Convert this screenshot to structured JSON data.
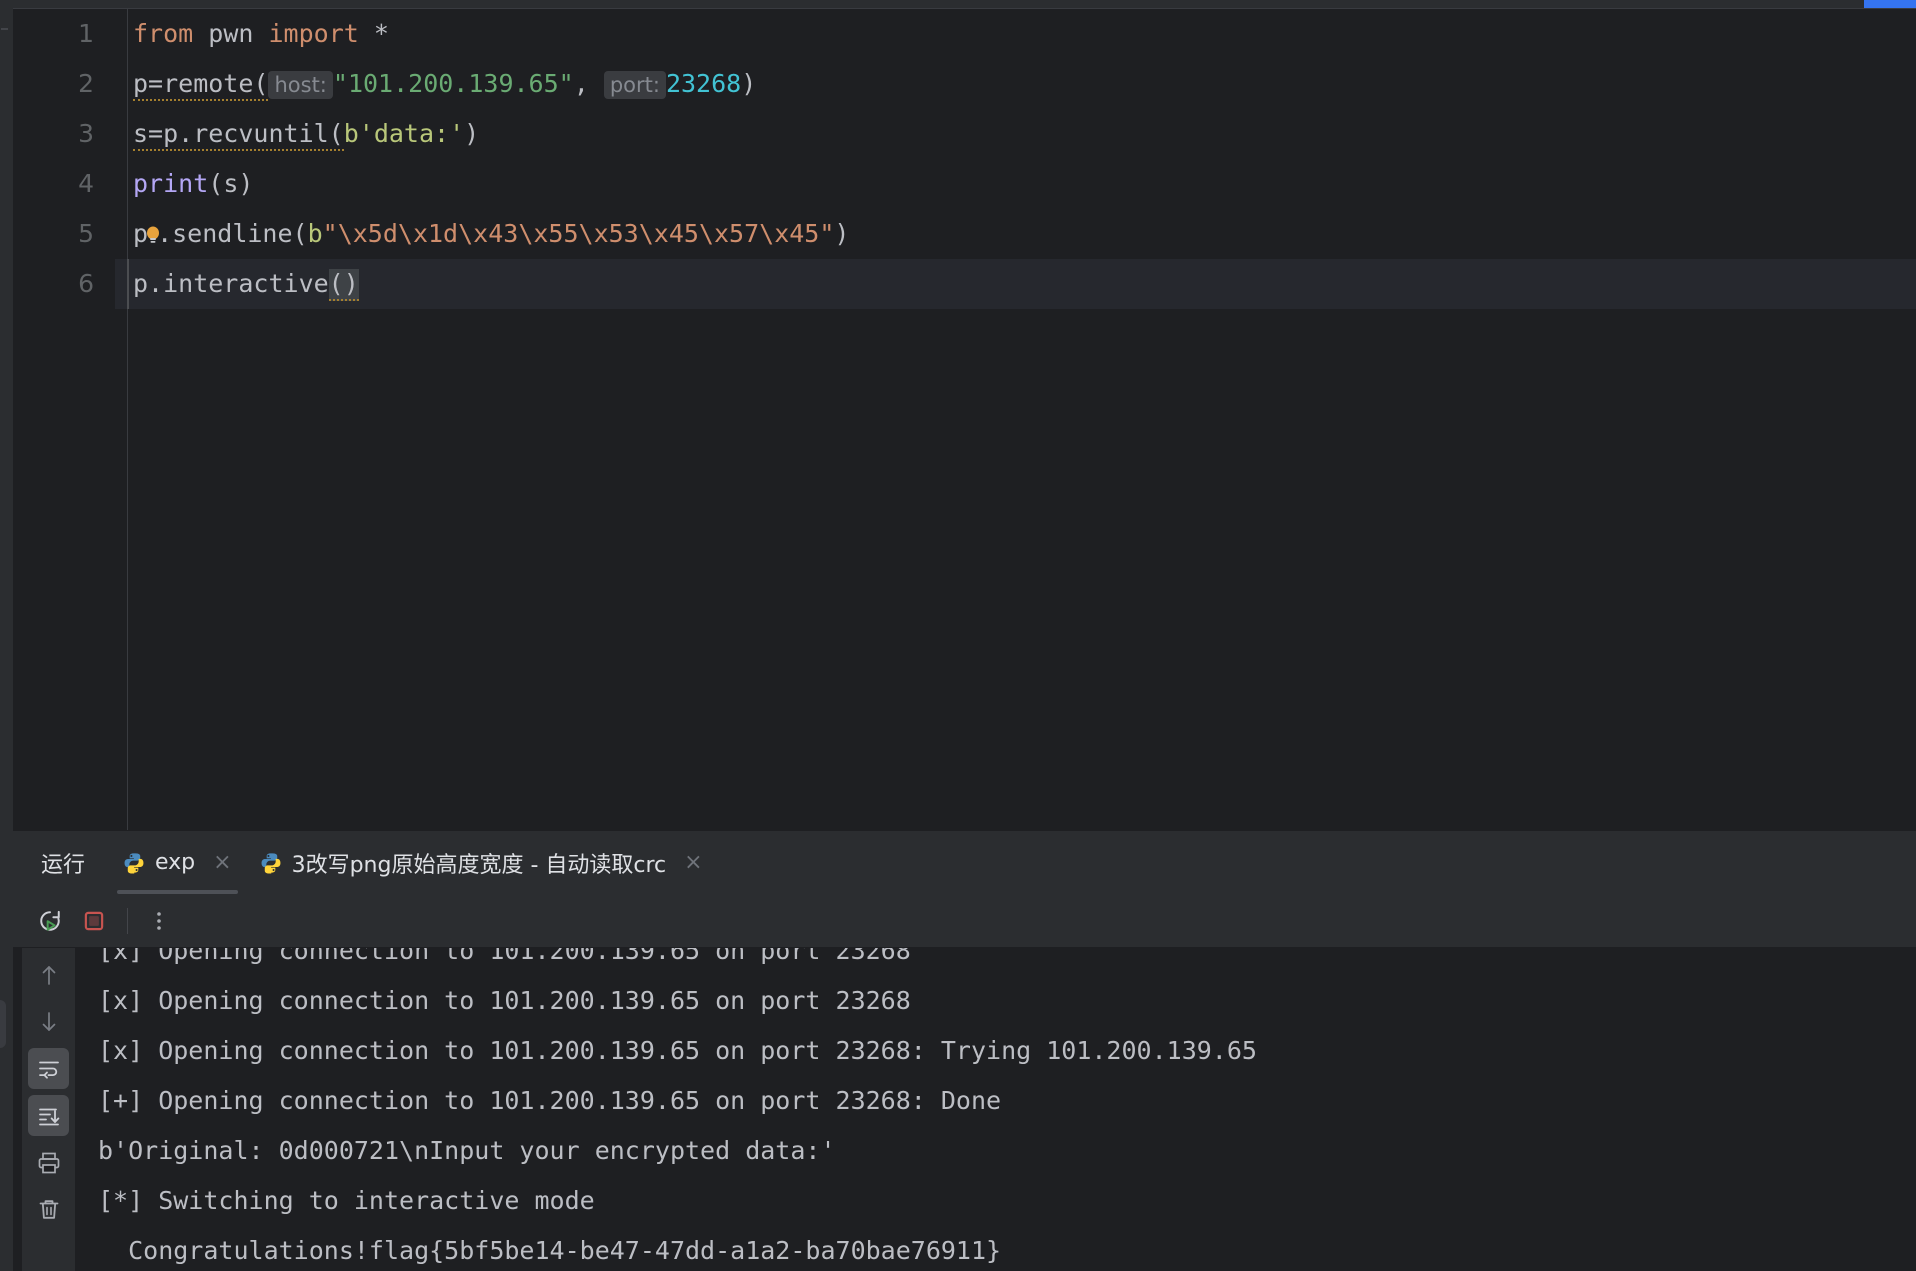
{
  "window": {
    "background": "#1e1f22",
    "panel_background": "#2b2d30"
  },
  "editor": {
    "language": "python",
    "gutter": [
      "1",
      "2",
      "3",
      "4",
      "5",
      "6"
    ],
    "current_line": 6,
    "lines": [
      {
        "n": "1",
        "text": "from pwn import *"
      },
      {
        "n": "2",
        "text": "p=remote( host: \"101.200.139.65\",  port: 23268)"
      },
      {
        "n": "3",
        "text": "s=p.recvuntil(b'data:')"
      },
      {
        "n": "4",
        "text": "print(s)"
      },
      {
        "n": "5",
        "text": "p.sendline(b\"\\x5d\\x1d\\x43\\x55\\x53\\x45\\x57\\x45\")"
      },
      {
        "n": "6",
        "text": "p.interactive()"
      }
    ],
    "tokens": {
      "kw_from": "from",
      "mod_pwn": " pwn ",
      "kw_import": "import",
      "star": " *",
      "l2_a": "p=remote(",
      "hint_host": "host:",
      "l2_ip": "\"101.200.139.65\"",
      "l2_comma": ", ",
      "hint_port": "port:",
      "l2_portnum": "23268",
      "l2_close": ")",
      "l3_a": "s=p.recvuntil(",
      "l3_b": "b",
      "l3_str": "'data:'",
      "l3_close": ")",
      "l4_fn": "print",
      "l4_args": "(s)",
      "l5_p": "p",
      "l5_dot_send": ".sendline(",
      "l5_b": "b",
      "l5_q1": "\"",
      "l5_esc": "\\x5d\\x1d\\x43\\x55\\x53\\x45\\x57\\x45",
      "l5_q2": "\"",
      "l5_close": ")",
      "l6_a": "p.interactive",
      "l6_parens": "()"
    },
    "colors": {
      "keyword": "#cf8e6d",
      "string": "#6aab73",
      "number": "#42c3d4",
      "function": "#b4a7f5",
      "bytes_string": "#b9c77a",
      "escape": "#cf8e6d",
      "default_text": "#bcbec4",
      "line_number": "#606366",
      "current_line_bg": "#26282e",
      "param_hint_bg": "#3a3c40",
      "param_hint_fg": "#868a91"
    }
  },
  "run_panel": {
    "title": "运行",
    "tabs": [
      {
        "label": "exp",
        "icon": "python-file-icon",
        "active": true,
        "close": "×"
      },
      {
        "label": "3改写png原始高度宽度 - 自动读取crc",
        "icon": "python-file-icon",
        "active": false,
        "close": "×"
      }
    ],
    "toolbar": [
      {
        "name": "rerun-button",
        "icon": "rerun-icon"
      },
      {
        "name": "stop-button",
        "icon": "stop-square-icon"
      },
      {
        "name": "more-options-button",
        "icon": "more-vertical-icon"
      }
    ],
    "rail": [
      {
        "name": "scroll-up-button",
        "icon": "arrow-up-icon",
        "active": false
      },
      {
        "name": "scroll-down-button",
        "icon": "arrow-down-icon",
        "active": false
      },
      {
        "name": "soft-wrap-button",
        "icon": "soft-wrap-icon",
        "active": true
      },
      {
        "name": "scroll-to-end-button",
        "icon": "scroll-to-end-icon",
        "active": true
      },
      {
        "name": "print-button",
        "icon": "printer-icon",
        "active": false
      },
      {
        "name": "clear-all-button",
        "icon": "trash-icon",
        "active": false
      }
    ],
    "output": [
      "[x] Opening connection to 101.200.139.65 on port 23268",
      "[x] Opening connection to 101.200.139.65 on port 23268: Trying 101.200.139.65",
      "[+] Opening connection to 101.200.139.65 on port 23268: Done",
      "b'Original: 0d000721\\nInput your encrypted data:'",
      "[*] Switching to interactive mode",
      "  Congratulations!flag{5bf5be14-be47-47dd-a1a2-ba70bae76911}"
    ],
    "output_text_color": "#bcbec4"
  },
  "accent": {
    "blue": "#3574f0",
    "green": "#499c54",
    "red": "#c75450"
  }
}
